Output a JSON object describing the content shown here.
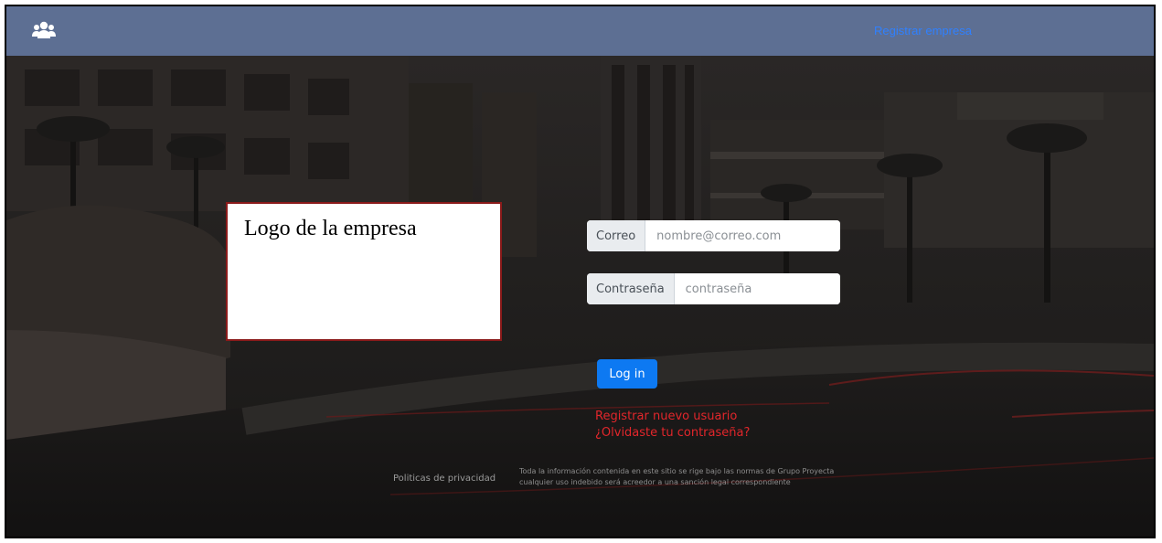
{
  "navbar": {
    "logo_icon": "users-icon",
    "register_company_label": "Registrar empresa",
    "background_color": "#5d6f93",
    "link_color": "#2f80ff"
  },
  "logo_placeholder": {
    "text": "Logo de la empresa"
  },
  "login_form": {
    "email_label": "Correo",
    "email_placeholder": "nombre@correo.com",
    "password_label": "Contraseña",
    "password_placeholder": "contraseña",
    "login_button": "Log in",
    "button_color": "#0d79f2"
  },
  "links": {
    "register_user": "Registrar nuevo usuario",
    "forgot_password": "¿Olvidaste tu contraseña?",
    "link_color": "#e2262b"
  },
  "footer": {
    "privacy_label": "Politicas de privacidad",
    "note_line1": "Toda la información contenida en este sitio se rige bajo las normas de Grupo Proyecta",
    "note_line2": "cualquier uso indebido será acreedor a una sanción legal correspondiente"
  }
}
